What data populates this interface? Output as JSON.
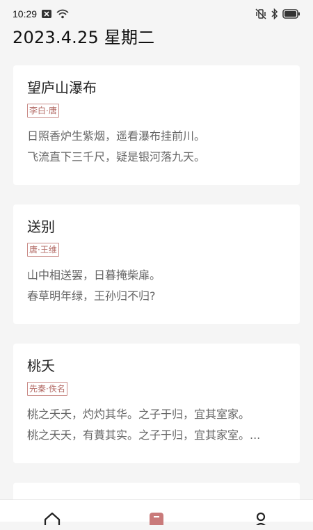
{
  "status_bar": {
    "time": "10:29",
    "icons": [
      "notification-x-icon",
      "wifi-icon",
      "vibrate-mute-icon",
      "bluetooth-icon",
      "battery-icon"
    ]
  },
  "header": {
    "date": "2023.4.25 星期二"
  },
  "poems": [
    {
      "title": "望庐山瀑布",
      "author_tag": "李白·唐",
      "lines": [
        "日照香炉生紫烟，遥看瀑布挂前川。",
        "飞流直下三千尺，疑是银河落九天。"
      ]
    },
    {
      "title": "送别",
      "author_tag": "唐·王维",
      "lines": [
        "山中相送罢，日暮掩柴扉。",
        "春草明年绿，王孙归不归?"
      ]
    },
    {
      "title": "桃夭",
      "author_tag": "先秦·佚名",
      "lines": [
        "桃之夭夭，灼灼其华。之子于归，宜其室家。",
        "桃之夭夭，有蕡其实。之子于归，宜其家室。..."
      ]
    }
  ],
  "bottom_nav": {
    "items": [
      "home-icon",
      "poem-icon",
      "profile-icon"
    ],
    "active_color": "#c97a7a"
  },
  "colors": {
    "background": "#f5f5f5",
    "card": "#ffffff",
    "tag_border": "#c98a86",
    "tag_text": "#b36b66"
  }
}
